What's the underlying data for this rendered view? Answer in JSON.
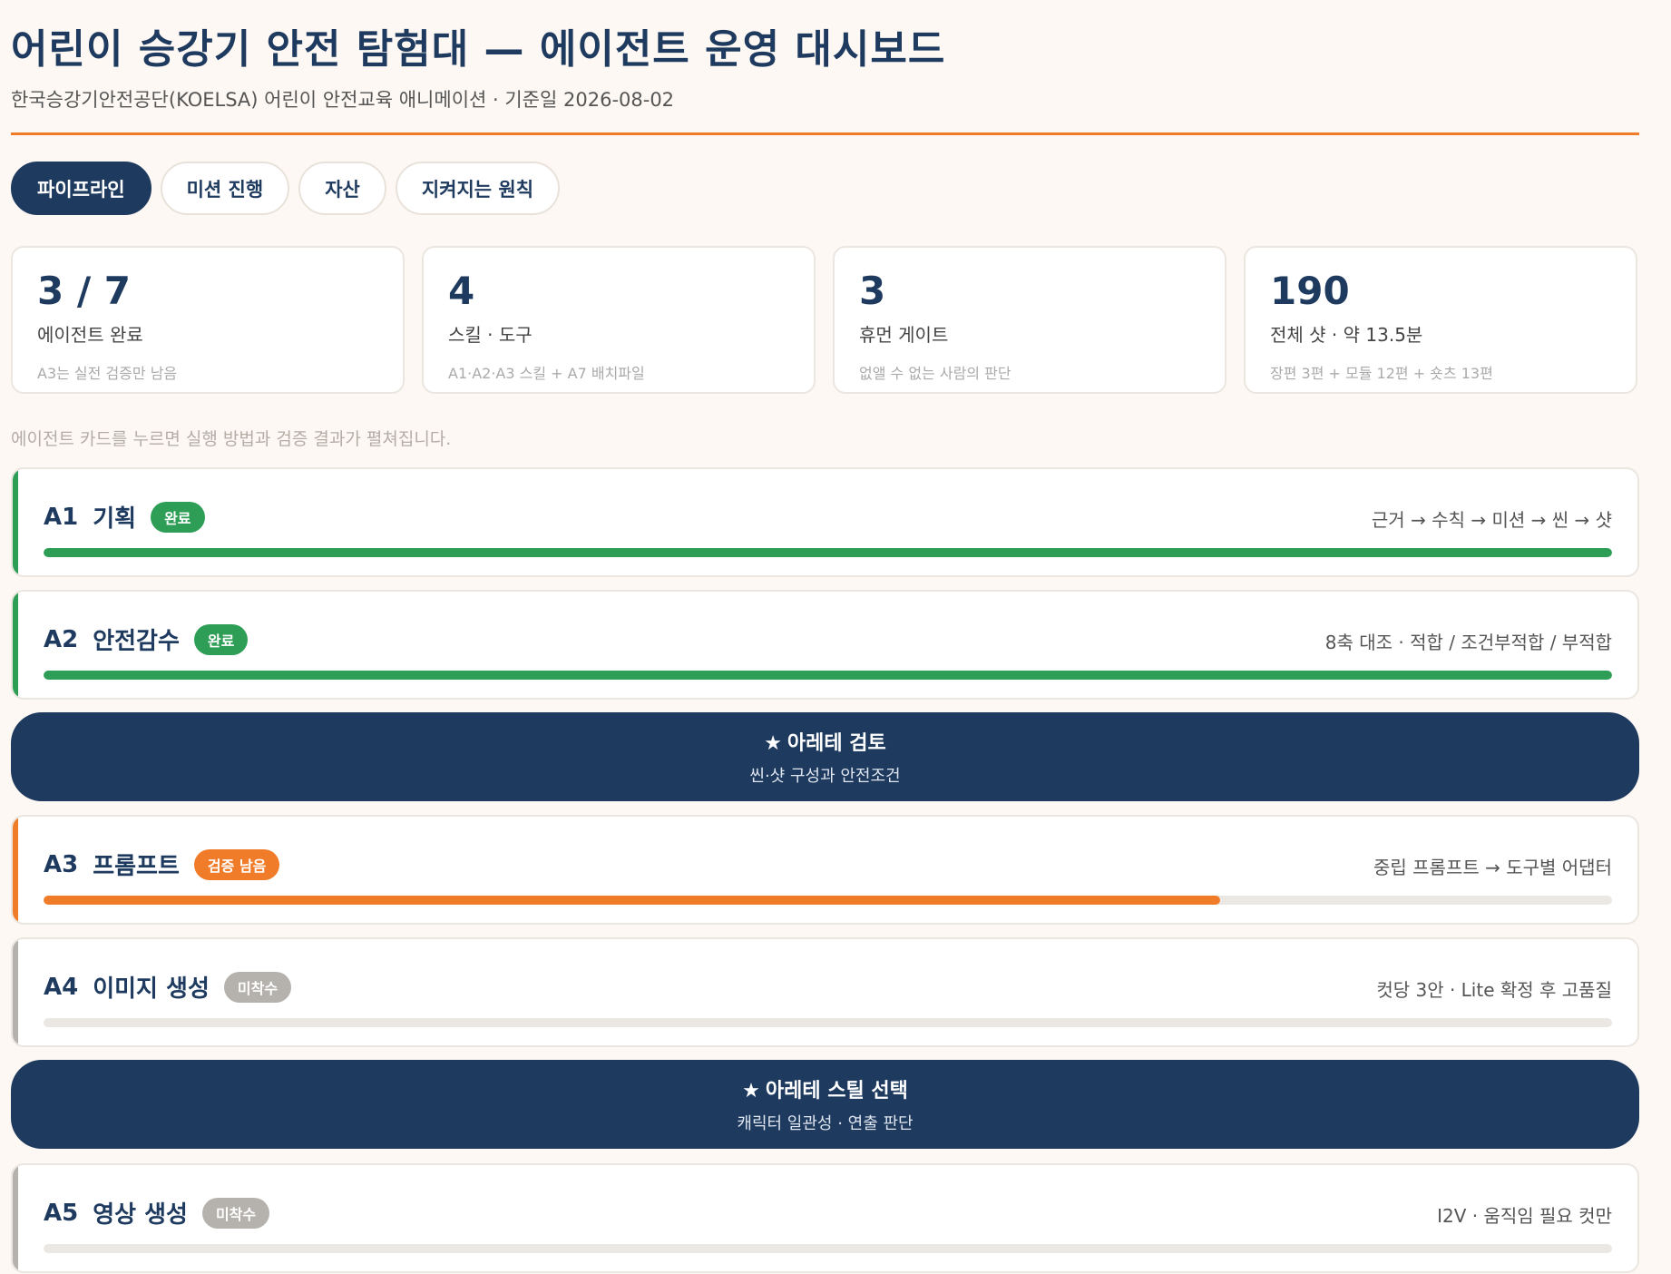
{
  "header": {
    "title": "어린이 승강기 안전 탐험대 — 에이전트 운영 대시보드",
    "subtitle": "한국승강기안전공단(KOELSA) 어린이 안전교육 애니메이션 · 기준일 2026-08-02"
  },
  "tabs": [
    {
      "label": "파이프라인",
      "active": true
    },
    {
      "label": "미션 진행",
      "active": false
    },
    {
      "label": "자산",
      "active": false
    },
    {
      "label": "지켜지는 원칙",
      "active": false
    }
  ],
  "stats": [
    {
      "value": "3 / 7",
      "label": "에이전트 완료",
      "note": "A3는 실전 검증만 남음"
    },
    {
      "value": "4",
      "label": "스킬 · 도구",
      "note": "A1·A2·A3 스킬 + A7 배치파일"
    },
    {
      "value": "3",
      "label": "휴먼 게이트",
      "note": "없앨 수 없는 사람의 판단"
    },
    {
      "value": "190",
      "label": "전체 샷 · 약 13.5분",
      "note": "장편 3편 + 모듈 12편 + 숏츠 13편"
    }
  ],
  "hint": "에이전트 카드를 누르면 실행 방법과 검증 결과가 펼쳐집니다.",
  "agents": [
    {
      "id": "A1",
      "name": "기획",
      "badge": "완료",
      "flow": "근거 → 수칙 → 미션 → 씬 → 샷",
      "progress": 1.0,
      "color": "#2e9e57"
    },
    {
      "id": "A2",
      "name": "안전감수",
      "badge": "완료",
      "flow": "8축 대조 · 적합 / 조건부적합 / 부적합",
      "progress": 1.0,
      "color": "#2e9e57"
    },
    {
      "id": "A3",
      "name": "프롬프트",
      "badge": "검증 남음",
      "flow": "중립 프롬프트 → 도구별 어댑터",
      "progress": 0.75,
      "color": "#f07c2a"
    },
    {
      "id": "A4",
      "name": "이미지 생성",
      "badge": "미착수",
      "flow": "컷당 3안 · Lite 확정 후 고품질",
      "progress": 0.0,
      "color": "#b5b2ae"
    },
    {
      "id": "A5",
      "name": "영상 생성",
      "badge": "미착수",
      "flow": "I2V · 움직임 필요 컷만",
      "progress": 0.0,
      "color": "#b5b2ae"
    }
  ],
  "gates": [
    {
      "star": "★",
      "title": "아레테 검토",
      "subtitle": "씬·샷 구성과 안전조건"
    },
    {
      "star": "★",
      "title": "아레테 스틸 선택",
      "subtitle": "캐릭터 일관성 · 연출 판단"
    }
  ]
}
